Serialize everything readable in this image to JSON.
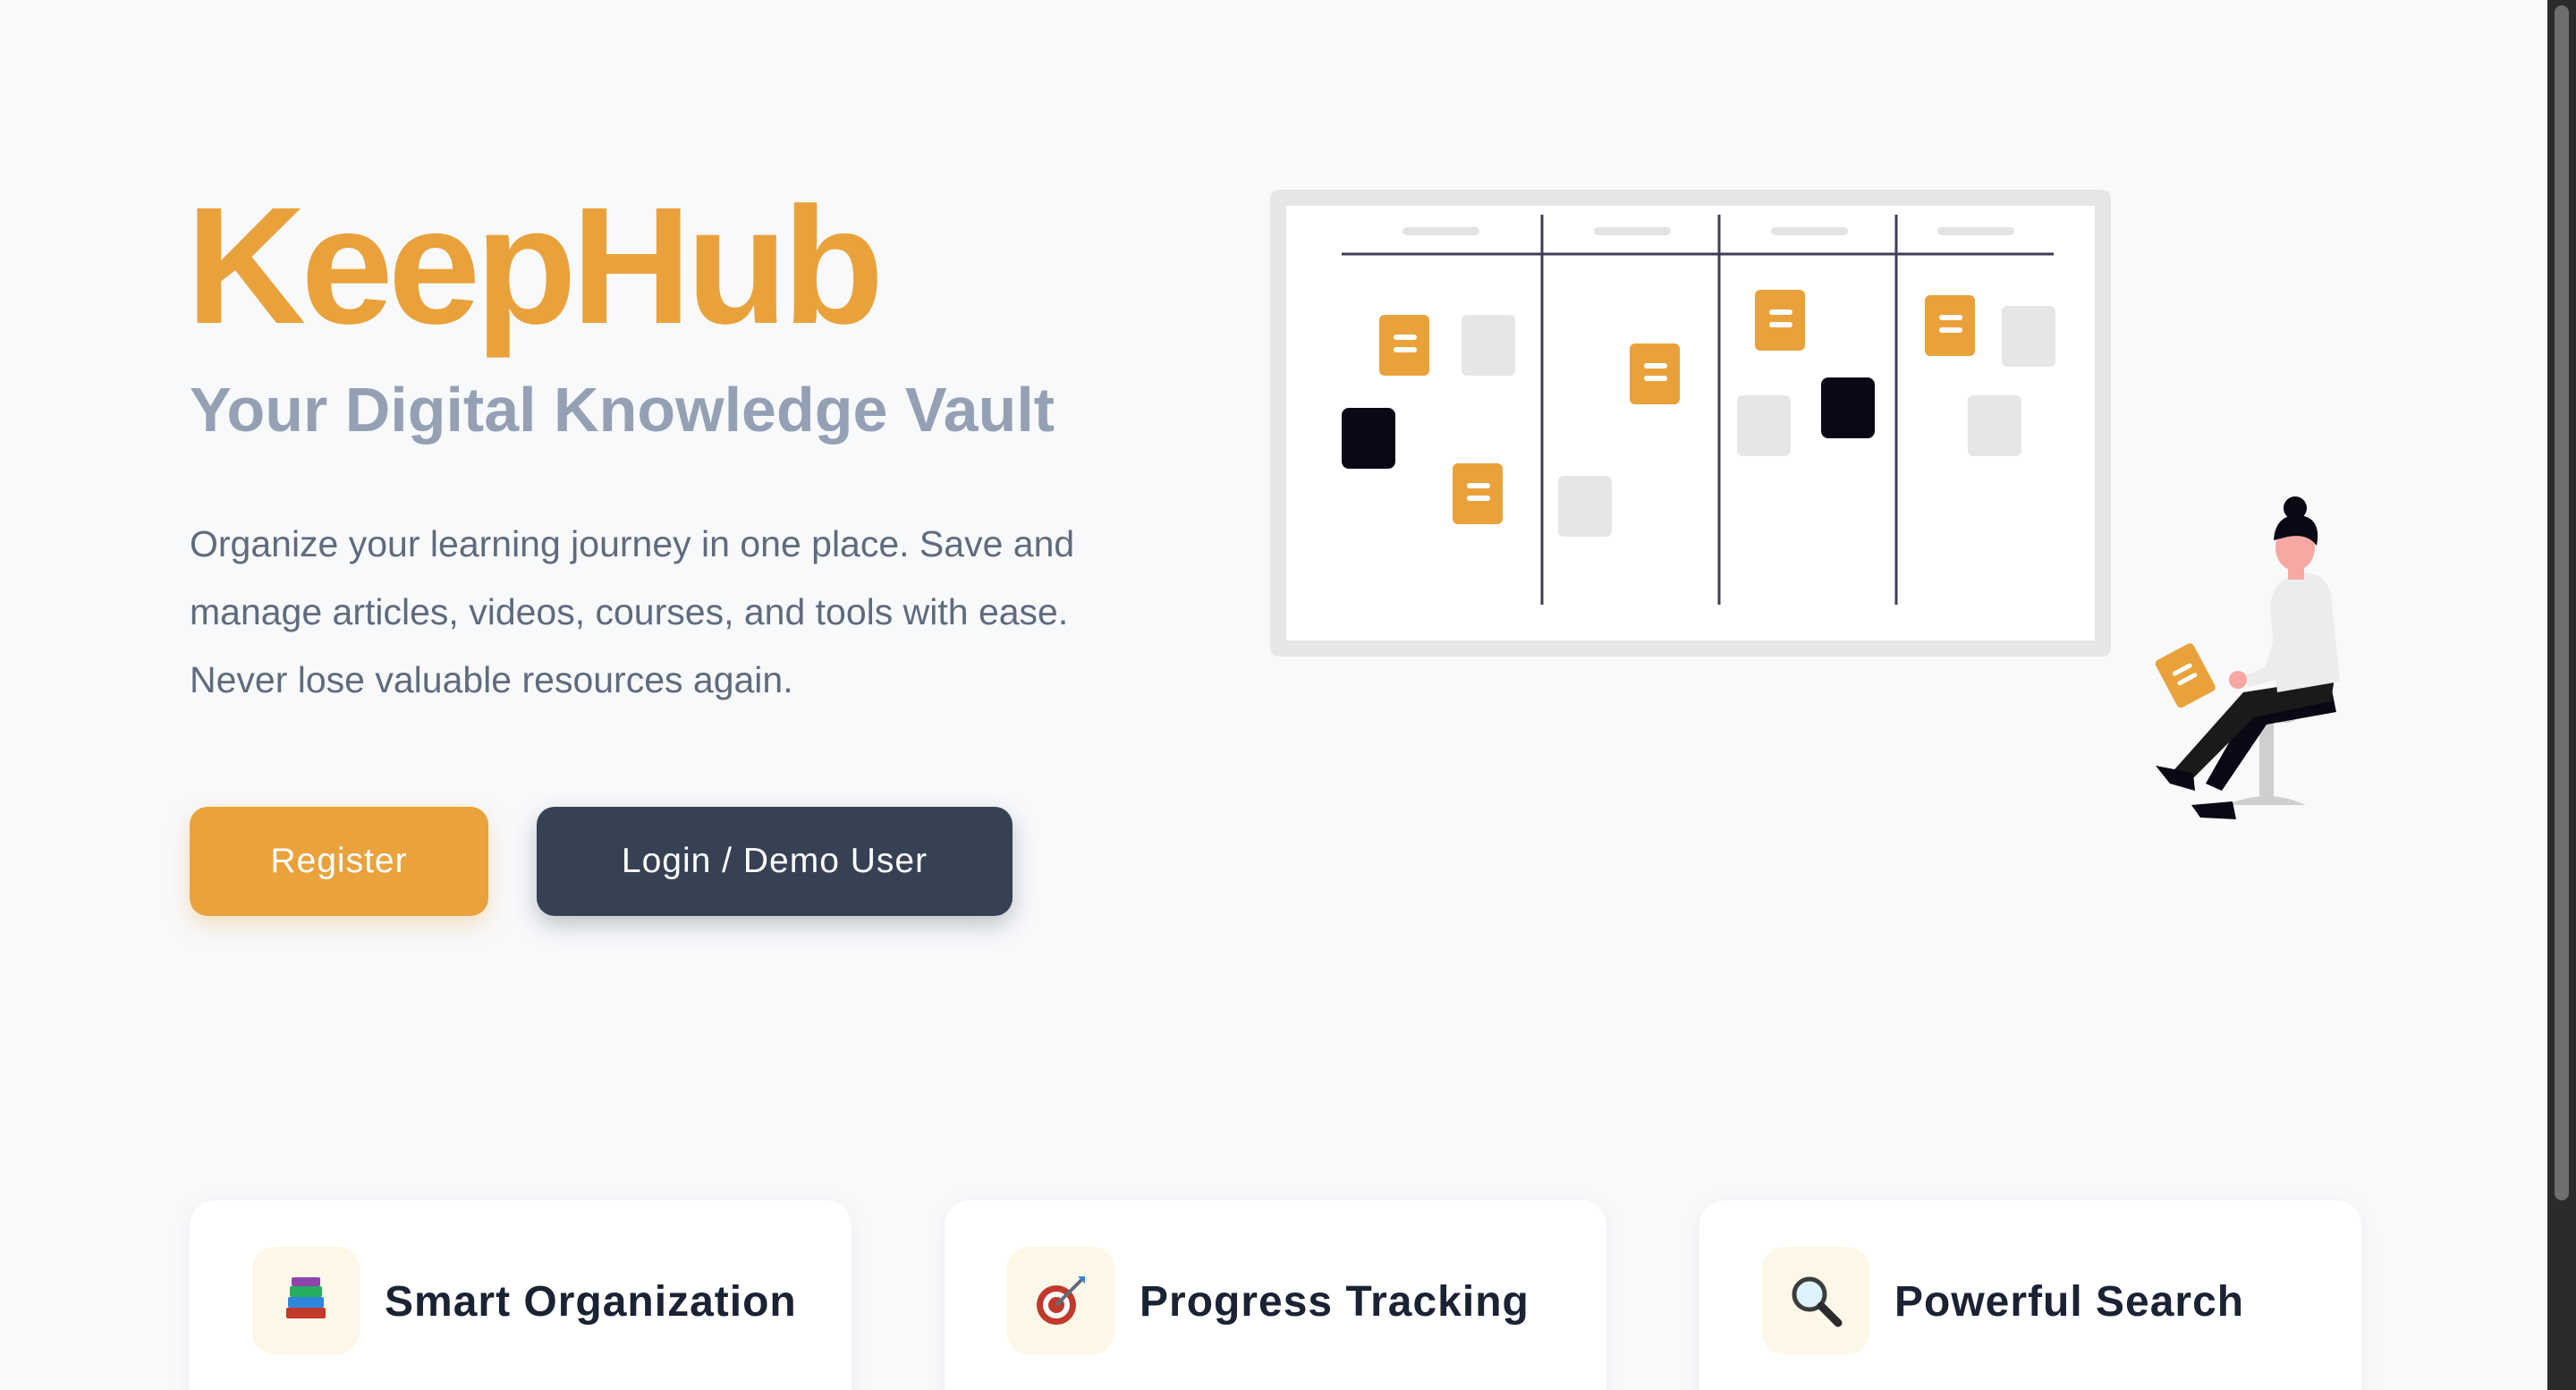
{
  "hero": {
    "title": "KeepHub",
    "tagline": "Your Digital Knowledge Vault",
    "description": "Organize your learning journey in one place. Save and manage articles, videos, courses, and tools with ease. Never lose valuable resources again.",
    "register_label": "Register",
    "login_label": "Login / Demo User"
  },
  "features": [
    {
      "title": "Smart Organization",
      "icon": "books-icon"
    },
    {
      "title": "Progress Tracking",
      "icon": "target-icon"
    },
    {
      "title": "Powerful Search",
      "icon": "magnifier-icon"
    }
  ],
  "colors": {
    "brand": "#e9a23b",
    "dark_button": "#364154",
    "tagline": "#94a0b4",
    "text": "#5f6b7d",
    "background": "#f8f9fb"
  }
}
